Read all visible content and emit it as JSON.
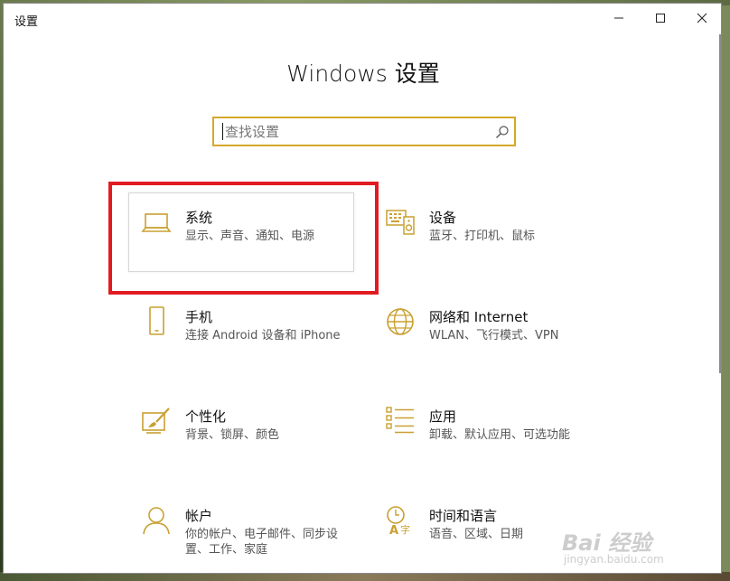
{
  "window": {
    "title": "设置",
    "minimize_label": "",
    "maximize_label": "",
    "close_label": ""
  },
  "page": {
    "title": "Windows 设置"
  },
  "search": {
    "placeholder": "查找设置",
    "value": ""
  },
  "tiles": [
    {
      "id": "system",
      "title": "系统",
      "desc": "显示、声音、通知、电源",
      "icon": "laptop-icon",
      "selected": true
    },
    {
      "id": "devices",
      "title": "设备",
      "desc": "蓝牙、打印机、鼠标",
      "icon": "keyboard-speaker-icon"
    },
    {
      "id": "phone",
      "title": "手机",
      "desc": "连接 Android 设备和 iPhone",
      "icon": "phone-icon"
    },
    {
      "id": "network",
      "title": "网络和 Internet",
      "desc": "WLAN、飞行模式、VPN",
      "icon": "globe-icon"
    },
    {
      "id": "personalization",
      "title": "个性化",
      "desc": "背景、锁屏、颜色",
      "icon": "paint-brush-icon"
    },
    {
      "id": "apps",
      "title": "应用",
      "desc": "卸载、默认应用、可选功能",
      "icon": "app-list-icon"
    },
    {
      "id": "accounts",
      "title": "帐户",
      "desc": "你的帐户、电子邮件、同步设置、工作、家庭",
      "icon": "person-icon"
    },
    {
      "id": "time-language",
      "title": "时间和语言",
      "desc": "语音、区域、日期",
      "icon": "clock-language-icon"
    }
  ],
  "colors": {
    "accent": "#d4a82a",
    "highlight": "#e11b22",
    "icon": "#c9a031"
  },
  "watermark": {
    "text": "Bai 经验",
    "url": "jingyan.baidu.com"
  }
}
